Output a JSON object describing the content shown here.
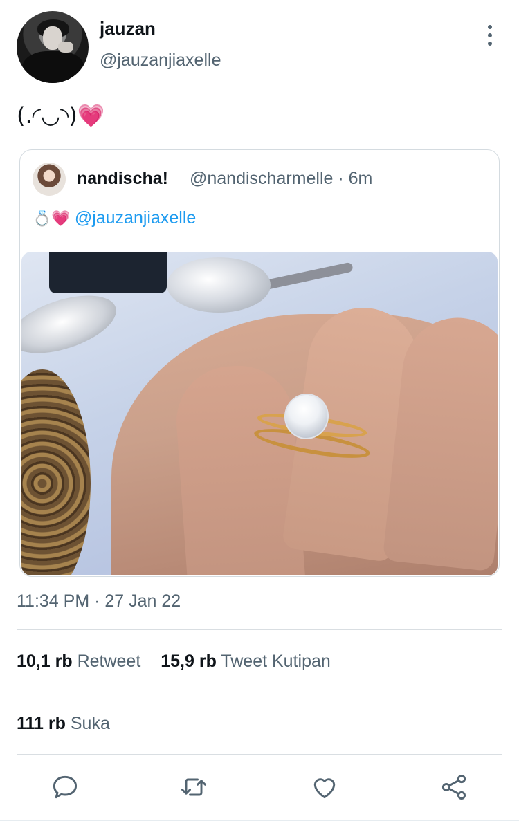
{
  "author": {
    "display_name": "jauzan",
    "handle": "@jauzanjiaxelle"
  },
  "tweet": {
    "text": "(.◜◡◝)",
    "emoji": "💗",
    "timestamp": "11:34 PM · 27 Jan 22"
  },
  "quoted": {
    "display_name": "nandischa!",
    "handle_time": "@nandischarmelle · 6m",
    "emoji_ring": "💍",
    "emoji_heart": "💗",
    "mention": "@jauzanjiaxelle"
  },
  "stats": {
    "retweets_count": "10,1 rb",
    "retweets_label": "Retweet",
    "quotes_count": "15,9 rb",
    "quotes_label": "Tweet Kutipan",
    "likes_count": "111 rb",
    "likes_label": "Suka"
  },
  "icons": {
    "more": "more-vertical-icon",
    "reply": "reply-icon",
    "retweet": "retweet-icon",
    "like": "heart-icon",
    "share": "share-icon"
  },
  "colors": {
    "mention": "#1d9bf0",
    "secondary_text": "#536471",
    "primary_text": "#0f1419",
    "icon": "#536471"
  }
}
